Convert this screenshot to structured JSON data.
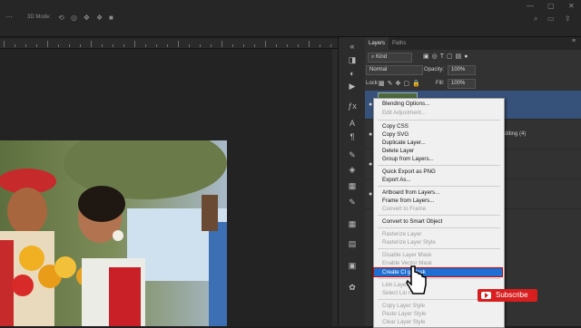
{
  "topbar": {
    "mode_label": "3D Mode:",
    "icons": [
      "orbit-icon",
      "roll-icon",
      "pan-icon",
      "slide-icon",
      "scale-icon",
      "camera-icon"
    ],
    "right_icons": [
      "search-icon",
      "workspace-icon",
      "share-icon"
    ]
  },
  "panel": {
    "tabs": [
      "Layers",
      "Paths"
    ],
    "filter_label": "Kind",
    "blend_mode": "Normal",
    "opacity_label": "Opacity:",
    "opacity_value": "100%",
    "lock_label": "Lock:",
    "fill_label": "Fill:",
    "fill_value": "100%",
    "partial_layer_text": "Editing (4)"
  },
  "menu": {
    "groups": [
      {
        "items": [
          {
            "label": "Blending Options...",
            "enabled": true
          },
          {
            "label": "Edit Adjustment...",
            "enabled": false
          }
        ]
      },
      {
        "items": [
          {
            "label": "Copy CSS",
            "enabled": true
          },
          {
            "label": "Copy SVG",
            "enabled": true
          },
          {
            "label": "Duplicate Layer...",
            "enabled": true
          },
          {
            "label": "Delete Layer",
            "enabled": true
          },
          {
            "label": "Group from Layers...",
            "enabled": true
          }
        ]
      },
      {
        "items": [
          {
            "label": "Quick Export as PNG",
            "enabled": true
          },
          {
            "label": "Export As...",
            "enabled": true
          }
        ]
      },
      {
        "items": [
          {
            "label": "Artboard from Layers...",
            "enabled": true
          },
          {
            "label": "Frame from Layers...",
            "enabled": true
          },
          {
            "label": "Convert to Frame",
            "enabled": false
          }
        ]
      },
      {
        "items": [
          {
            "label": "Convert to Smart Object",
            "enabled": true
          }
        ]
      },
      {
        "items": [
          {
            "label": "Rasterize Layer",
            "enabled": false
          },
          {
            "label": "Rasterize Layer Style",
            "enabled": false
          }
        ]
      },
      {
        "items": [
          {
            "label": "Disable Layer Mask",
            "enabled": false
          },
          {
            "label": "Enable Vector Mask",
            "enabled": false
          },
          {
            "label": "Create Cl    g Mask",
            "enabled": true,
            "highlighted": true
          }
        ]
      },
      {
        "items": [
          {
            "label": "Link Layer",
            "enabled": false
          },
          {
            "label": "Select Lin          rs",
            "enabled": false
          }
        ]
      },
      {
        "items": [
          {
            "label": "Copy Layer Style",
            "enabled": false
          },
          {
            "label": "Paste Layer Style",
            "enabled": false
          },
          {
            "label": "Clear Layer Style",
            "enabled": false
          }
        ]
      }
    ]
  },
  "subscribe": {
    "label": "Subscribe",
    "color": "#d81e1e"
  },
  "colors": {
    "highlight": "#1e6fd1",
    "highlight_border": "#d60000",
    "menu_bg": "#f0f0f0"
  }
}
